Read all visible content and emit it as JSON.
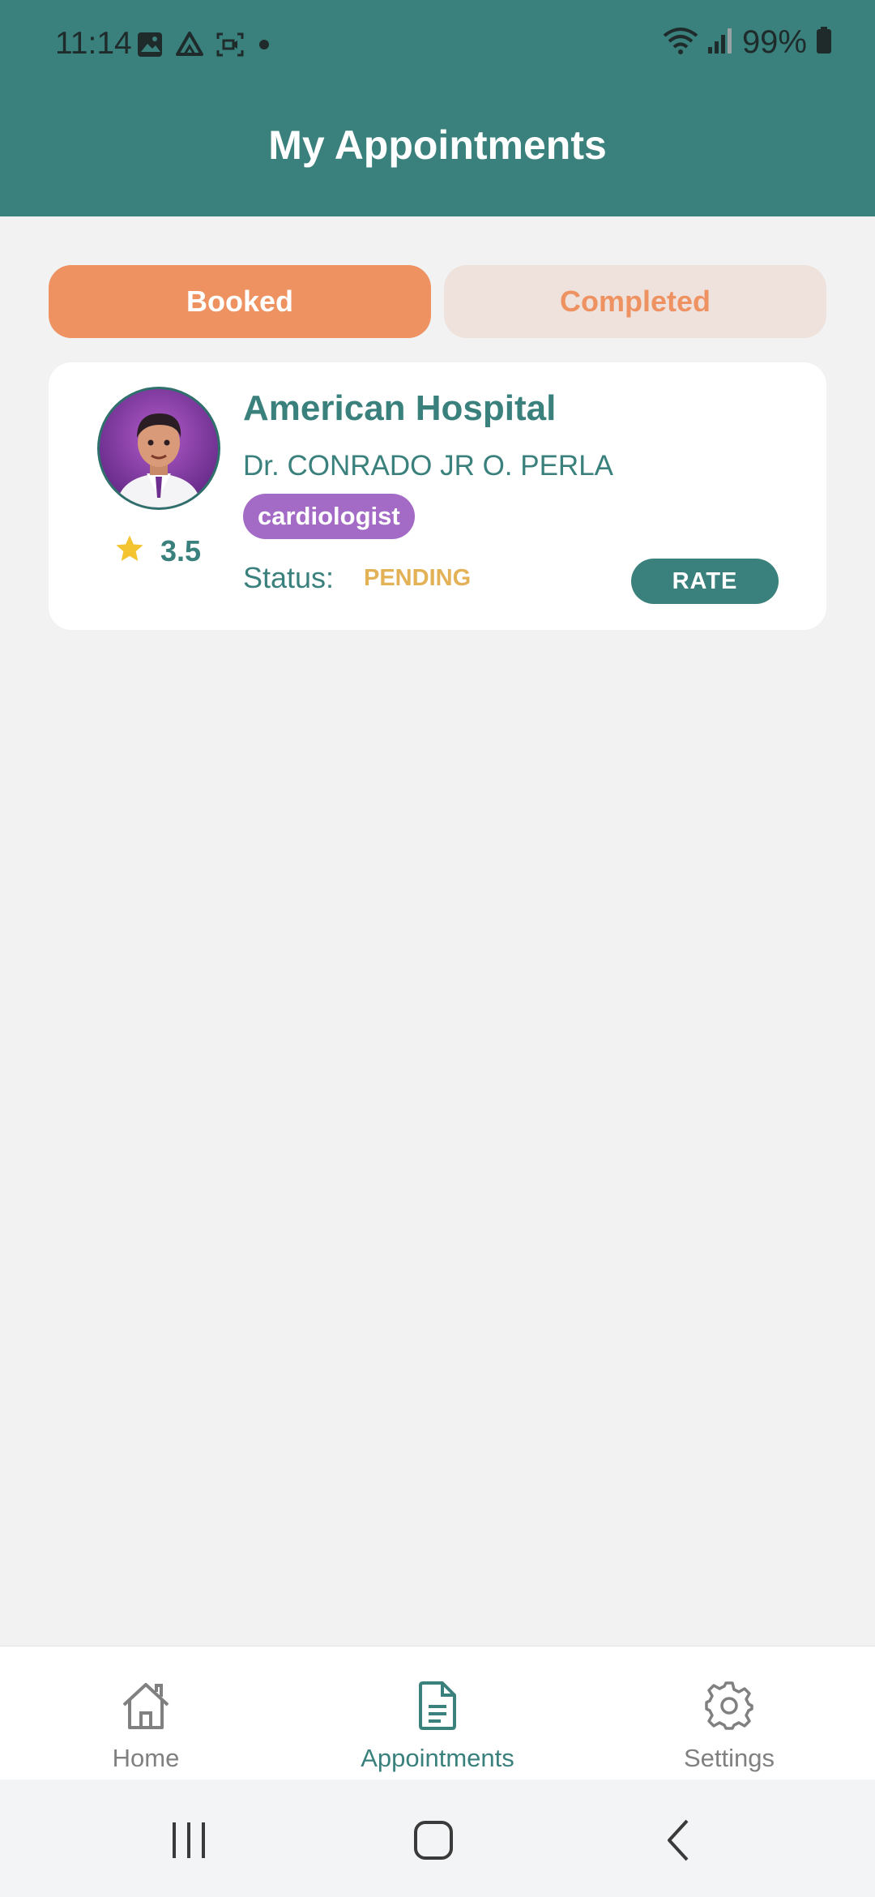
{
  "status_bar": {
    "time": "11:14",
    "battery": "99%"
  },
  "header": {
    "title": "My Appointments",
    "background_color": "#3a807c"
  },
  "tabs": [
    {
      "label": "Booked",
      "active": true
    },
    {
      "label": "Completed",
      "active": false
    }
  ],
  "appointment": {
    "hospital": "American Hospital",
    "doctor": "Dr. CONRADO JR O. PERLA",
    "specialty": "cardiologist",
    "rating": "3.5",
    "status_label": "Status:",
    "status_value": "PENDING",
    "rate_label": "RATE"
  },
  "bottom_nav": {
    "items": [
      {
        "label": "Home",
        "icon": "home-icon",
        "active": false
      },
      {
        "label": "Appointments",
        "icon": "document-icon",
        "active": true
      },
      {
        "label": "Settings",
        "icon": "gear-icon",
        "active": false
      }
    ]
  },
  "colors": {
    "primary": "#3a807c",
    "accent": "#ee9262",
    "specialty_badge": "#a36bc6",
    "pending": "#e3b156",
    "star": "#f4c430"
  }
}
